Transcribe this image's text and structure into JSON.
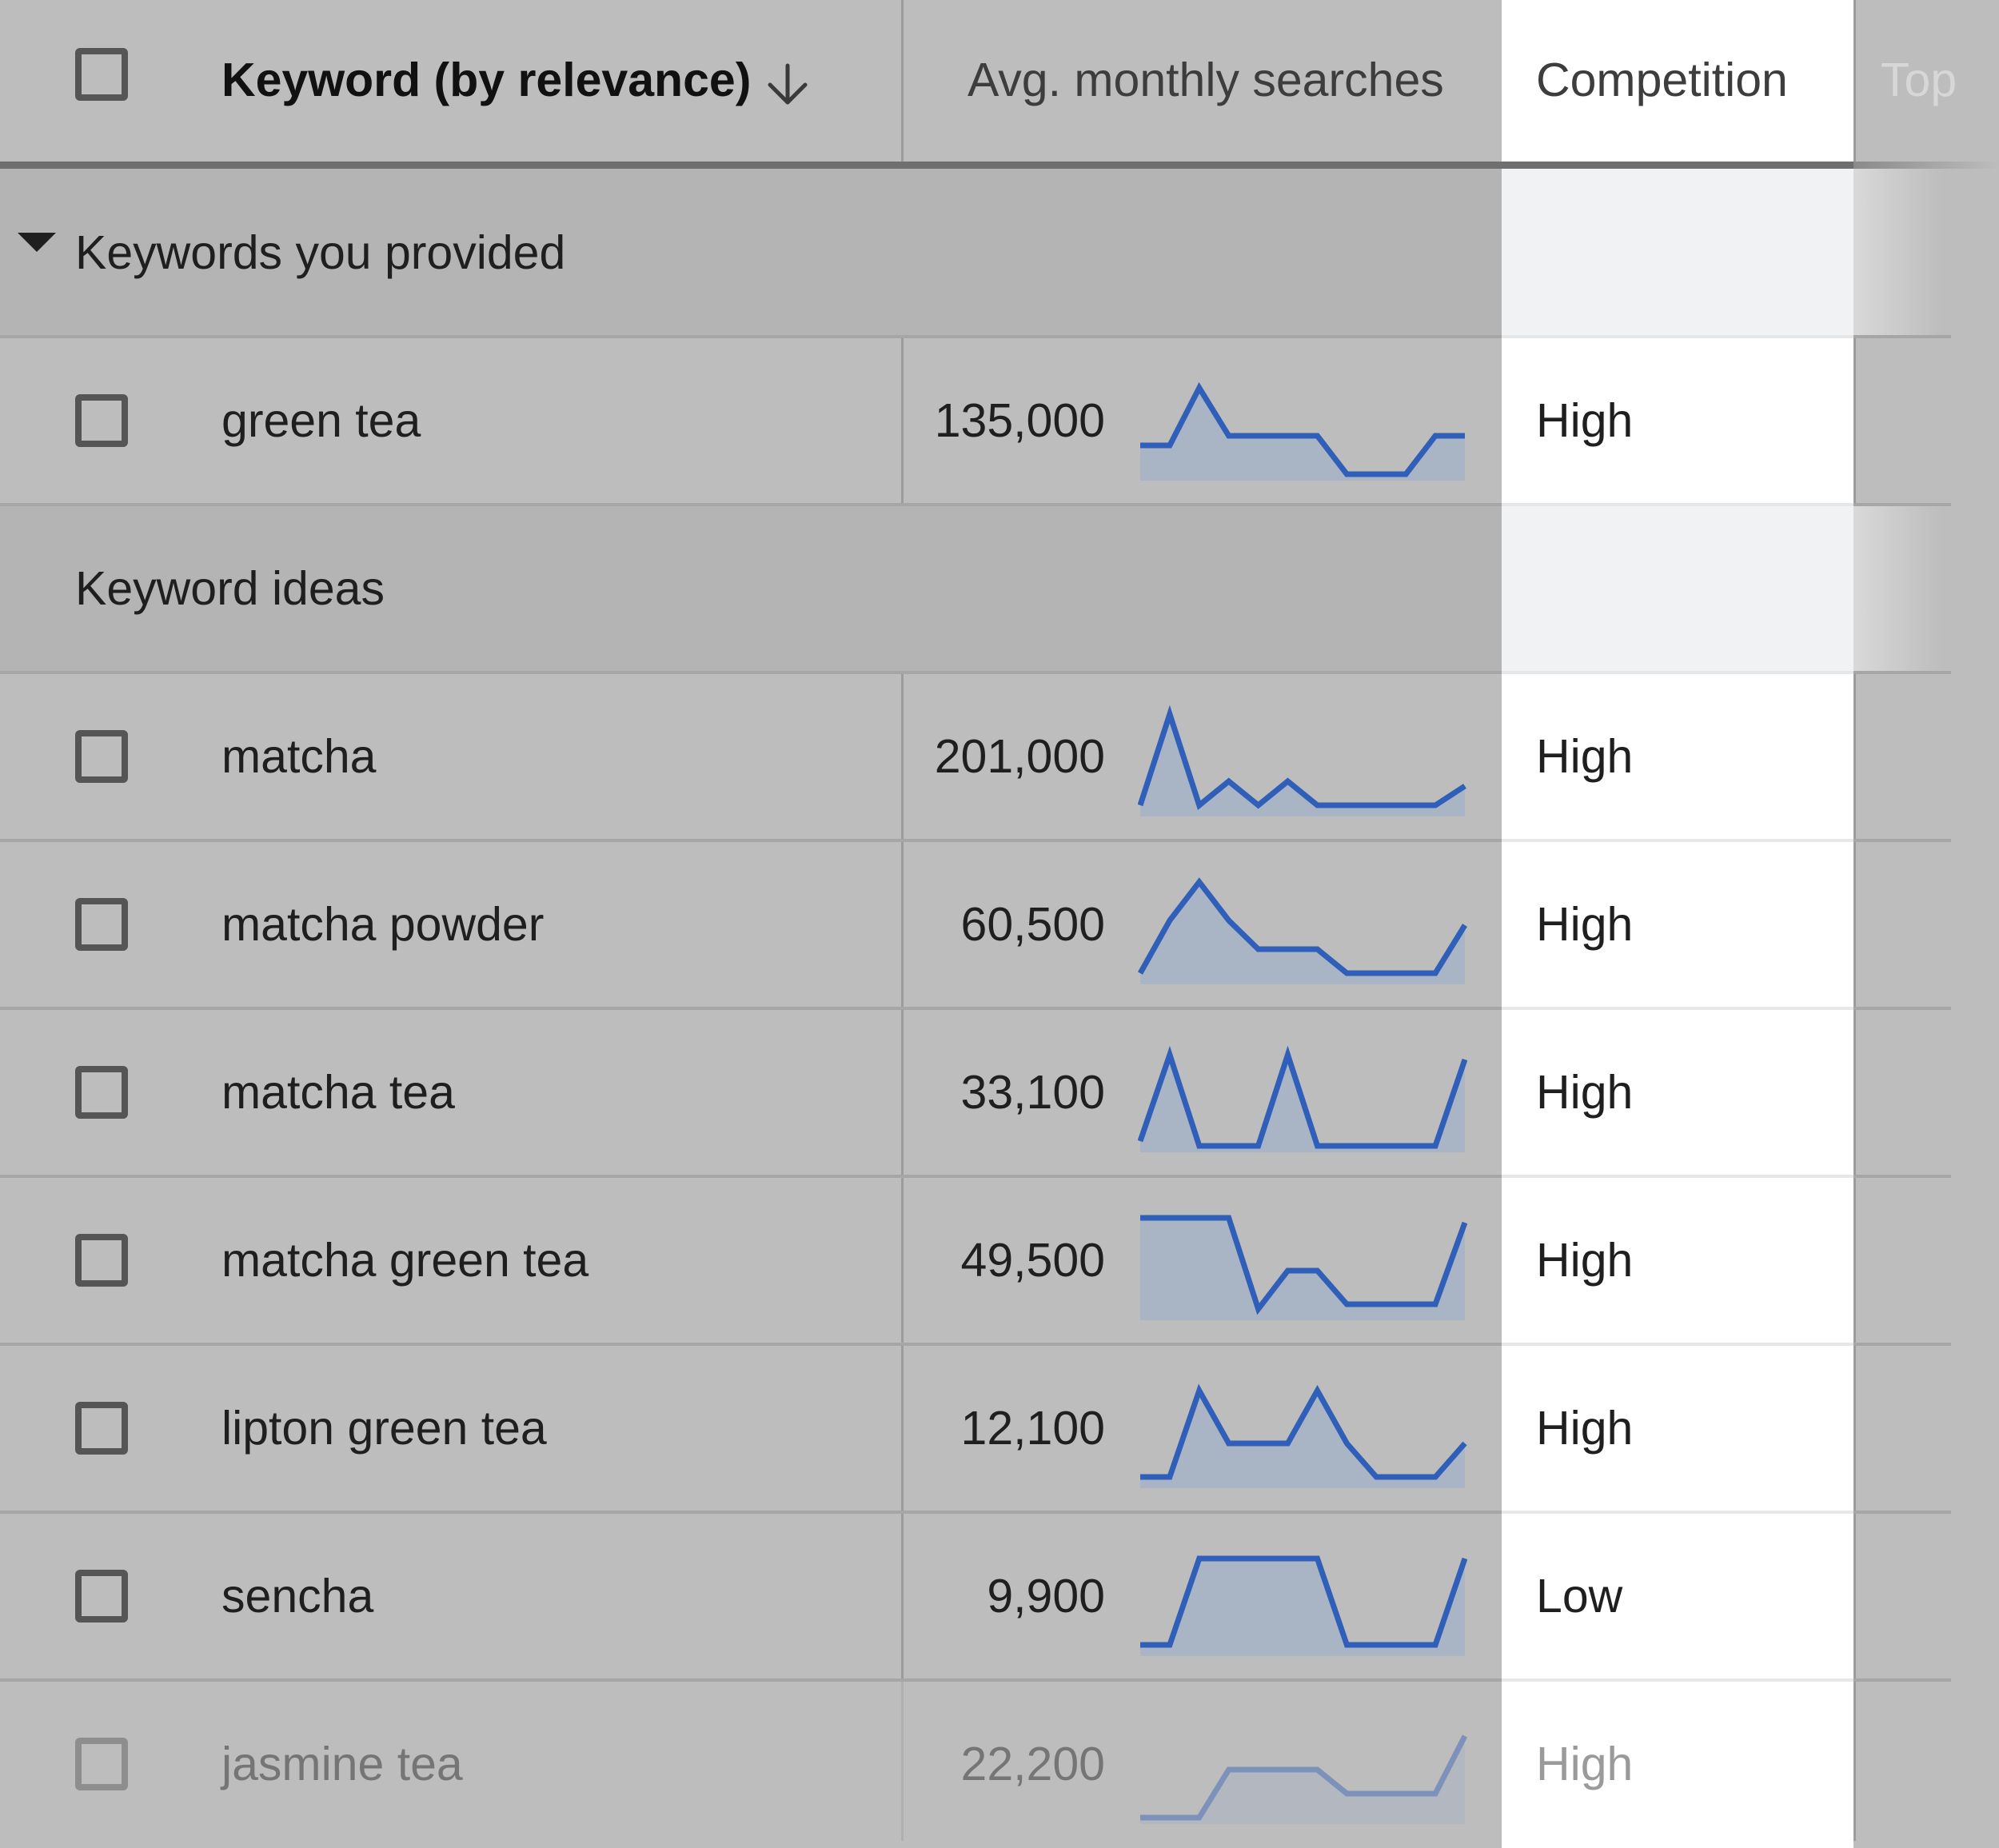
{
  "header": {
    "keyword_label": "Keyword (by relevance)",
    "searches_label": "Avg. monthly searches",
    "competition_label": "Competition",
    "top_label": "Top",
    "sort_icon": "arrow-down-icon"
  },
  "groups": {
    "provided_label": "Keywords you provided",
    "ideas_label": "Keyword ideas"
  },
  "colors": {
    "spark_line": "#2f5fb8",
    "spark_fill": "#a9b4c4"
  },
  "rows": [
    {
      "keyword": "green tea",
      "searches": "135,000",
      "competition": "High",
      "trend": [
        0.3,
        0.3,
        0.9,
        0.4,
        0.4,
        0.4,
        0.4,
        0.0,
        0.0,
        0.0,
        0.4,
        0.4
      ]
    },
    {
      "keyword": "matcha",
      "searches": "201,000",
      "competition": "High",
      "trend": [
        0.05,
        1.0,
        0.05,
        0.3,
        0.05,
        0.3,
        0.05,
        0.05,
        0.05,
        0.05,
        0.05,
        0.25
      ]
    },
    {
      "keyword": "matcha powder",
      "searches": "60,500",
      "competition": "High",
      "trend": [
        0.05,
        0.6,
        1.0,
        0.6,
        0.3,
        0.3,
        0.3,
        0.05,
        0.05,
        0.05,
        0.05,
        0.55
      ]
    },
    {
      "keyword": "matcha tea",
      "searches": "33,100",
      "competition": "High",
      "trend": [
        0.05,
        0.95,
        0.0,
        0.0,
        0.0,
        0.95,
        0.0,
        0.0,
        0.0,
        0.0,
        0.0,
        0.9
      ]
    },
    {
      "keyword": "matcha green tea",
      "searches": "49,500",
      "competition": "High",
      "trend": [
        1.0,
        1.0,
        1.0,
        1.0,
        0.05,
        0.45,
        0.45,
        0.1,
        0.1,
        0.1,
        0.1,
        0.95
      ]
    },
    {
      "keyword": "lipton green tea",
      "searches": "12,100",
      "competition": "High",
      "trend": [
        0.05,
        0.05,
        0.95,
        0.4,
        0.4,
        0.4,
        0.95,
        0.4,
        0.05,
        0.05,
        0.05,
        0.4
      ]
    },
    {
      "keyword": "sencha",
      "searches": "9,900",
      "competition": "Low",
      "trend": [
        0.05,
        0.05,
        0.95,
        0.95,
        0.95,
        0.95,
        0.95,
        0.05,
        0.05,
        0.05,
        0.05,
        0.95
      ]
    },
    {
      "keyword": "jasmine tea",
      "searches": "22,200",
      "competition": "High",
      "trend": [
        0.0,
        0.0,
        0.0,
        0.5,
        0.5,
        0.5,
        0.5,
        0.25,
        0.25,
        0.25,
        0.25,
        0.85
      ]
    }
  ]
}
